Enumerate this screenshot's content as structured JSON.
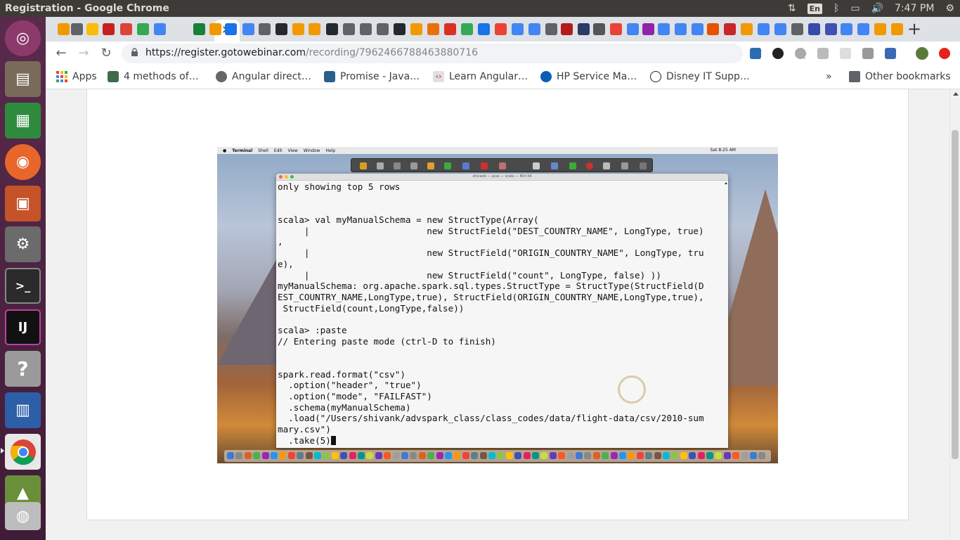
{
  "topbar": {
    "window_title": "Registration - Google Chrome",
    "keyboard_layout": "En",
    "clock": "7:47 PM"
  },
  "launcher": {
    "apps": [
      "ubuntu-dash-icon",
      "files-icon",
      "libreoffice-calc-icon",
      "firefox-icon",
      "libreoffice-impress-icon",
      "system-settings-icon",
      "terminal-icon",
      "intellij-icon",
      "help-icon",
      "libreoffice-writer-icon",
      "chrome-icon",
      "image-viewer-icon",
      "disk-icon"
    ],
    "intellij_label": "IJ",
    "terminal_label": ">_",
    "help_label": "?"
  },
  "browser": {
    "tab_close": "×",
    "new_tab": "+",
    "url_host": "https://register.gotowebinar.com",
    "url_path": "/recording/7962466788463880716",
    "nav": {
      "back": "←",
      "forward": "→",
      "reload": "↻"
    },
    "bookmark_star": "☆",
    "bookmarks": [
      {
        "label": "Apps",
        "icon": "apps-grid-icon"
      },
      {
        "label": "4 methods of…",
        "icon": "avatar-icon"
      },
      {
        "label": "Angular direct…",
        "icon": "globe-icon"
      },
      {
        "label": "Promise - Java…",
        "icon": "stackoverflow-icon"
      },
      {
        "label": "Learn Angular…",
        "icon": "code-icon"
      },
      {
        "label": "HP Service Ma…",
        "icon": "hp-icon"
      },
      {
        "label": "Disney IT Supp…",
        "icon": "disney-icon"
      }
    ],
    "bookmarks_overflow": "»",
    "other_bookmarks": "Other bookmarks"
  },
  "recording": {
    "mac_menu": [
      "Terminal",
      "Shell",
      "Edit",
      "View",
      "Window",
      "Help"
    ],
    "mac_clock": "Sat 8:25 AM",
    "terminal_title": "shivank — java — scala — 80×34",
    "terminal_lines": [
      "only showing top 5 rows",
      "",
      "",
      "scala> val myManualSchema = new StructType(Array(",
      "     |                      new StructField(\"DEST_COUNTRY_NAME\", LongType, true)",
      ",",
      "     |                      new StructField(\"ORIGIN_COUNTRY_NAME\", LongType, tru",
      "e),",
      "     |                      new StructField(\"count\", LongType, false) ))",
      "myManualSchema: org.apache.spark.sql.types.StructType = StructType(StructField(D",
      "EST_COUNTRY_NAME,LongType,true), StructField(ORIGIN_COUNTRY_NAME,LongType,true),",
      " StructField(count,LongType,false))",
      "",
      "scala> :paste",
      "// Entering paste mode (ctrl-D to finish)",
      "",
      "",
      "spark.read.format(\"csv\")",
      "  .option(\"header\", \"true\")",
      "  .option(\"mode\", \"FAILFAST\")",
      "  .schema(myManualSchema)",
      "  .load(\"/Users/shivank/advspark_class/class_codes/data/flight-data/csv/2010-sum",
      "mary.csv\")",
      "  .take(5)"
    ]
  },
  "colors": {
    "ubuntu_panel": "#3c3b37",
    "launcher": "#4a2340",
    "chrome_tabstrip": "#dee1e6",
    "terminal_bg": "#f6f6f6"
  }
}
